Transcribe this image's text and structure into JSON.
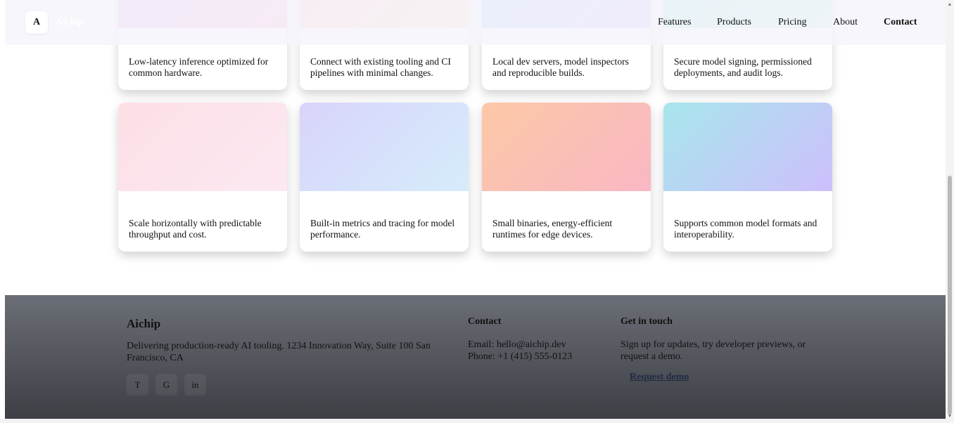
{
  "header": {
    "logo_letter": "A",
    "brand_name": "Aichip",
    "nav": [
      "Features",
      "Products",
      "Pricing",
      "About",
      "Contact"
    ],
    "active_nav": "Contact"
  },
  "cards": [
    {
      "text": "Low-latency inference optimized for common hardware.",
      "colors": [
        "#e4b5ee",
        "#f6b7cf"
      ]
    },
    {
      "text": "Connect with existing tooling and CI pipelines with minimal changes.",
      "colors": [
        "#fcc5cc",
        "#fde3bd"
      ]
    },
    {
      "text": "Local dev servers, model inspectors and reproducible builds.",
      "colors": [
        "#a9d0fb",
        "#cdbefc"
      ]
    },
    {
      "text": "Secure model signing, permissioned deployments, and audit logs.",
      "colors": [
        "#9fe8d9",
        "#c2f1e6"
      ]
    },
    {
      "text": "Scale horizontally with predictable throughput and cost.",
      "colors": [
        "#fddfe5",
        "#fce8f2"
      ]
    },
    {
      "text": "Built-in metrics and tracing for model performance.",
      "colors": [
        "#d8d4fb",
        "#d6ecfb"
      ]
    },
    {
      "text": "Small binaries, energy-efficient runtimes for edge devices.",
      "colors": [
        "#fcc8a6",
        "#f9b7c4"
      ]
    },
    {
      "text": "Supports common model formats and interoperability.",
      "colors": [
        "#a7e6ec",
        "#cebffc"
      ]
    }
  ],
  "footer": {
    "brand": "Aichip",
    "description": "Delivering production-ready AI tooling. 1234 Innovation Way, Suite 100 San Francisco, CA",
    "socials": [
      "T",
      "G",
      "in"
    ],
    "contact_title": "Contact",
    "email": "Email: hello@aichip.dev",
    "phone": "Phone: +1 (415) 555-0123",
    "touch_title": "Get in touch",
    "touch_text": "Sign up for updates, try developer previews, or request a demo.",
    "demo_link": "Request demo"
  }
}
